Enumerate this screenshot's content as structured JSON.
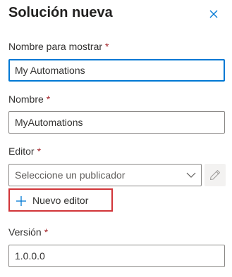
{
  "panel": {
    "title": "Solución nueva",
    "close_icon": "close-icon"
  },
  "required_marker": "*",
  "fields": {
    "display_name": {
      "label": "Nombre para mostrar",
      "value": "My Automations"
    },
    "name": {
      "label": "Nombre",
      "value": "MyAutomations"
    },
    "publisher": {
      "label": "Editor",
      "placeholder": "Seleccione un publicador",
      "chevron_icon": "chevron-down-icon",
      "edit_icon": "pencil-icon",
      "new_button_label": "Nuevo editor",
      "new_button_icon": "plus-icon"
    },
    "version": {
      "label": "Versión",
      "value": "1.0.0.0"
    }
  },
  "colors": {
    "accent": "#0078d4",
    "required": "#a4262c",
    "highlight_border": "#d13438"
  }
}
